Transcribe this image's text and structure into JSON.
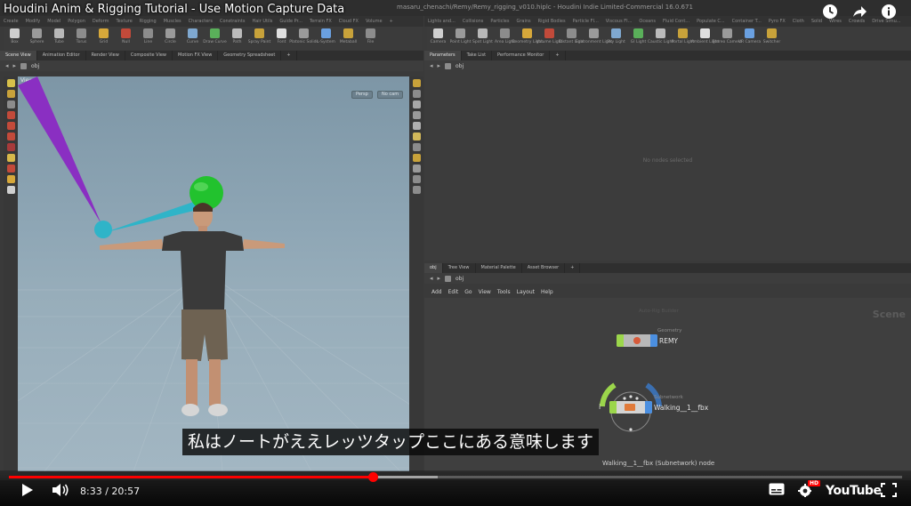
{
  "video": {
    "title": "Houdini Anim & Rigging Tutorial - Use Motion Capture Data",
    "caption": "私はノートがええレッツタップここにある意味します",
    "current_time": "8:33",
    "duration": "20:57",
    "time_display": "8:33 / 20:57",
    "progress_fraction": 0.408,
    "buffered_fraction": 0.48,
    "logo_text": "YouTube",
    "quality_badge": "HD"
  },
  "houdini": {
    "window_title": "masaru_chenachi/Remy/Remy_rigging_v010.hiplc - Houdini Indie Limited-Commercial 16.0.671",
    "shelf_tabs_left": [
      "Create",
      "Modify",
      "Model",
      "Polygon",
      "Deform",
      "Texture",
      "Rigging",
      "Muscles",
      "Characters",
      "Constraints",
      "Hair Utils",
      "Guide Pr...",
      "Terrain FX",
      "Cloud FX",
      "Volume",
      "+"
    ],
    "shelf_tabs_right": [
      "Lights and...",
      "Collisions",
      "Particles",
      "Grains",
      "Rigid Bodies",
      "Particle FI...",
      "Viscous FI...",
      "Oceans",
      "Fluid Cont...",
      "Populate C...",
      "Container T...",
      "Pyro FX",
      "Cloth",
      "Solid",
      "Wires",
      "Crowds",
      "Drive Simu..."
    ],
    "shelf_tools_left": [
      "Box",
      "Sphere",
      "Tube",
      "Torus",
      "Grid",
      "Null",
      "Line",
      "Circle",
      "Curve",
      "Draw Curve",
      "Path",
      "Spray Paint",
      "Font",
      "Platonic Solids",
      "L-System",
      "Metaball",
      "File"
    ],
    "shelf_tools_right": [
      "Camera",
      "Point Light",
      "Spot Light",
      "Area Light",
      "Geometry Light",
      "Volume Light",
      "Distant Light",
      "Environment Light",
      "Sky Light",
      "GI Light",
      "Caustic Light",
      "Portal Light",
      "Ambient Light",
      "Stereo Camera",
      "VR Camera",
      "Switcher"
    ],
    "left_pane_tabs": [
      "Scene View",
      "Animation Editor",
      "Render View",
      "Composite View",
      "Motion FX View",
      "Geometry Spreadsheet",
      "+"
    ],
    "right_top_tabs": [
      "Parameters",
      "Take List",
      "Performance Monitor",
      "+"
    ],
    "right_bottom_tabs": [
      "obj",
      "Tree View",
      "Material Palette",
      "Asset Browser",
      "+"
    ],
    "path": "obj",
    "viewport_label": "View",
    "persp_button": "Persp",
    "camera_button": "No cam",
    "no_selection": "No nodes selected",
    "net_menu": [
      "Add",
      "Edit",
      "Go",
      "View",
      "Tools",
      "Layout",
      "Help"
    ],
    "net_context": "Scene",
    "net_faded_label": "Auto-Rig Builder",
    "nodes": [
      {
        "category": "Geometry",
        "name": "REMY"
      },
      {
        "category": "Subnetwork",
        "name": "Walking__1__fbx"
      }
    ],
    "status_text": "Walking__1__fbx (Subnetwork) node"
  },
  "colors": {
    "youtube_red": "#ff0000",
    "node_green": "#9bd64b",
    "node_blue": "#4b8fe0",
    "bone_cyan": "#2fb4c8",
    "bone_purple": "#8a2fc2",
    "handle_green": "#22c22e"
  }
}
